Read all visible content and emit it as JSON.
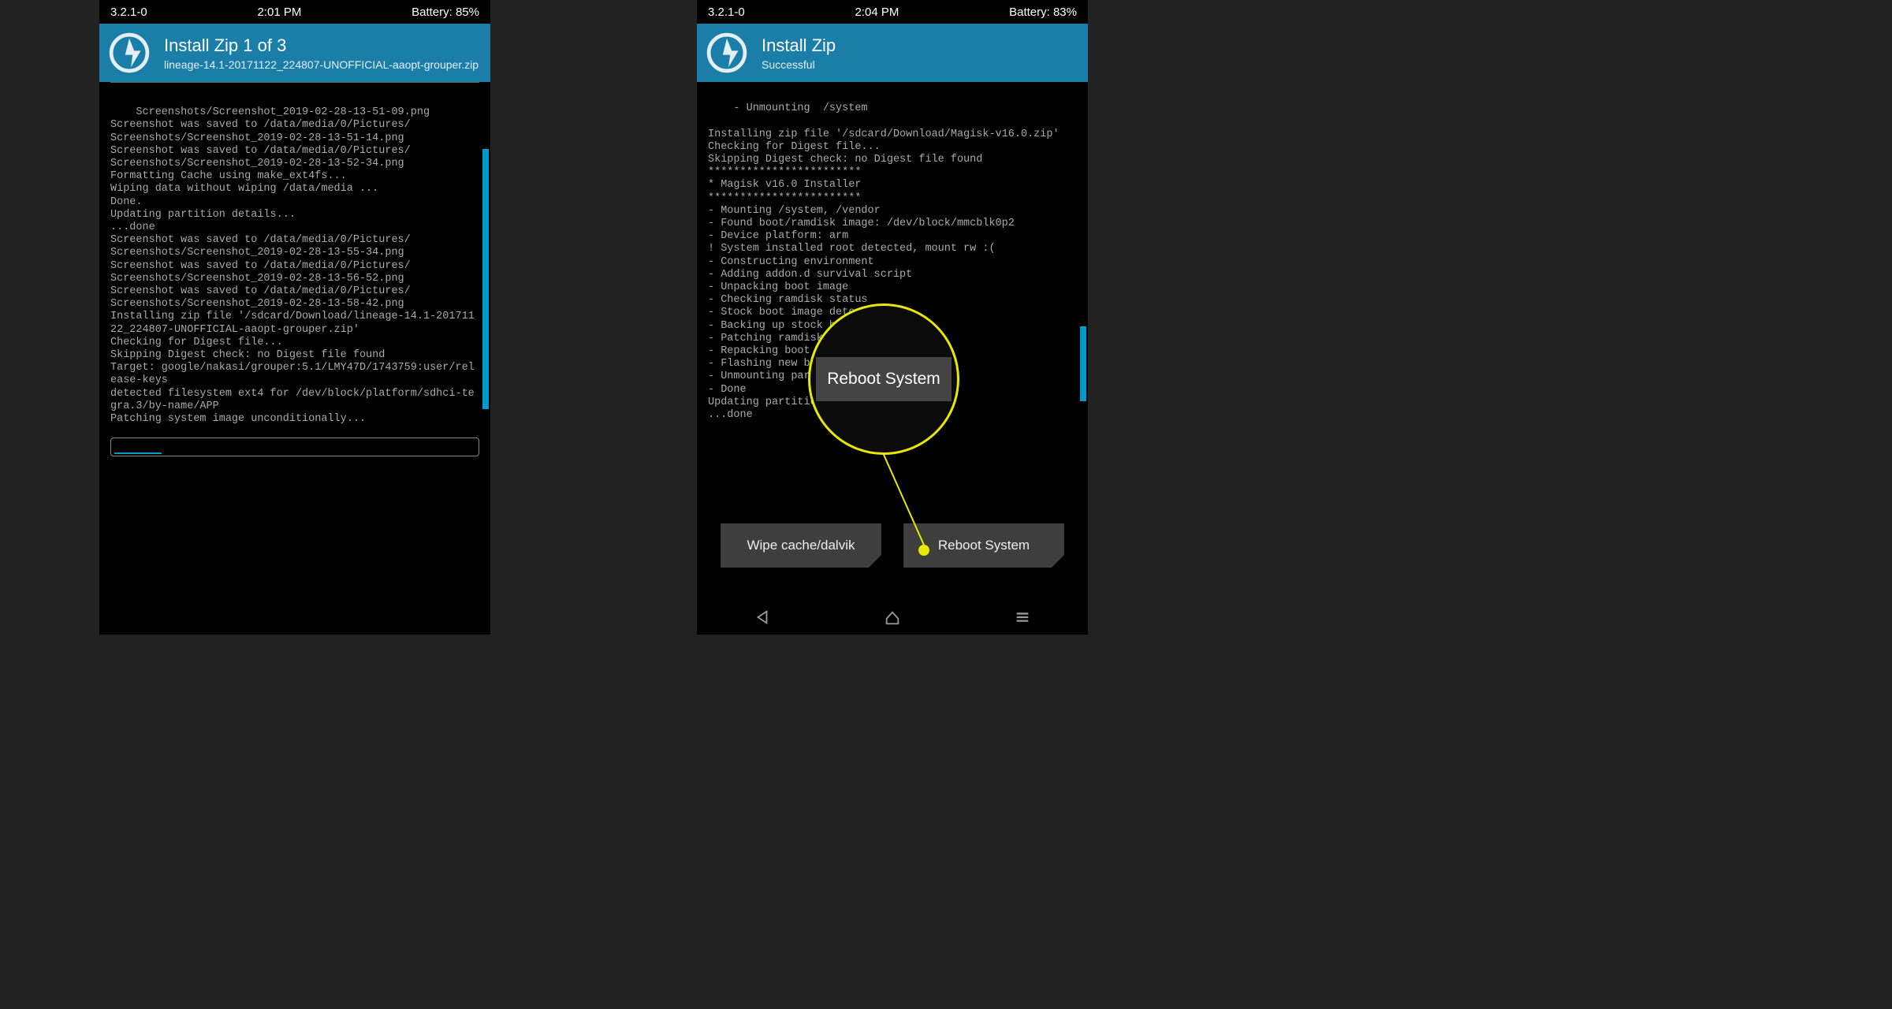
{
  "left": {
    "status": {
      "version": "3.2.1-0",
      "time": "2:01 PM",
      "battery": "Battery: 85%"
    },
    "header": {
      "title": "Install Zip 1 of 3",
      "subtitle": "lineage-14.1-20171122_224807-UNOFFICIAL-aaopt-grouper.zip"
    },
    "terminal": "Screenshots/Screenshot_2019-02-28-13-51-09.png\nScreenshot was saved to /data/media/0/Pictures/\nScreenshots/Screenshot_2019-02-28-13-51-14.png\nScreenshot was saved to /data/media/0/Pictures/\nScreenshots/Screenshot_2019-02-28-13-52-34.png\nFormatting Cache using make_ext4fs...\nWiping data without wiping /data/media ...\nDone.\nUpdating partition details...\n...done\nScreenshot was saved to /data/media/0/Pictures/\nScreenshots/Screenshot_2019-02-28-13-55-34.png\nScreenshot was saved to /data/media/0/Pictures/\nScreenshots/Screenshot_2019-02-28-13-56-52.png\nScreenshot was saved to /data/media/0/Pictures/\nScreenshots/Screenshot_2019-02-28-13-58-42.png\nInstalling zip file '/sdcard/Download/lineage-14.1-20171122_224807-UNOFFICIAL-aaopt-grouper.zip'\nChecking for Digest file...\nSkipping Digest check: no Digest file found\nTarget: google/nakasi/grouper:5.1/LMY47D/1743759:user/release-keys\ndetected filesystem ext4 for /dev/block/platform/sdhci-tegra.3/by-name/APP\nPatching system image unconditionally..."
  },
  "right": {
    "status": {
      "version": "3.2.1-0",
      "time": "2:04 PM",
      "battery": "Battery: 83%"
    },
    "header": {
      "title": "Install Zip",
      "subtitle": "Successful"
    },
    "terminal": "- Unmounting  /system\n\nInstalling zip file '/sdcard/Download/Magisk-v16.0.zip'\nChecking for Digest file...\nSkipping Digest check: no Digest file found\n************************\n* Magisk v16.0 Installer\n************************\n- Mounting /system, /vendor\n- Found boot/ramdisk image: /dev/block/mmcblk0p2\n- Device platform: arm\n! System installed root detected, mount rw :(\n- Constructing environment\n- Adding addon.d survival script\n- Unpacking boot image\n- Checking ramdisk status\n- Stock boot image detected!\n- Backing up stock boot image\n- Patching ramdisk\n- Repacking boot image\n- Flashing new boot image\n- Unmounting partitions\n- Done\nUpdating partition details...\n...done",
    "buttons": {
      "wipe": "Wipe cache/dalvik",
      "reboot": "Reboot System"
    }
  },
  "callout": {
    "label": "Reboot System"
  }
}
